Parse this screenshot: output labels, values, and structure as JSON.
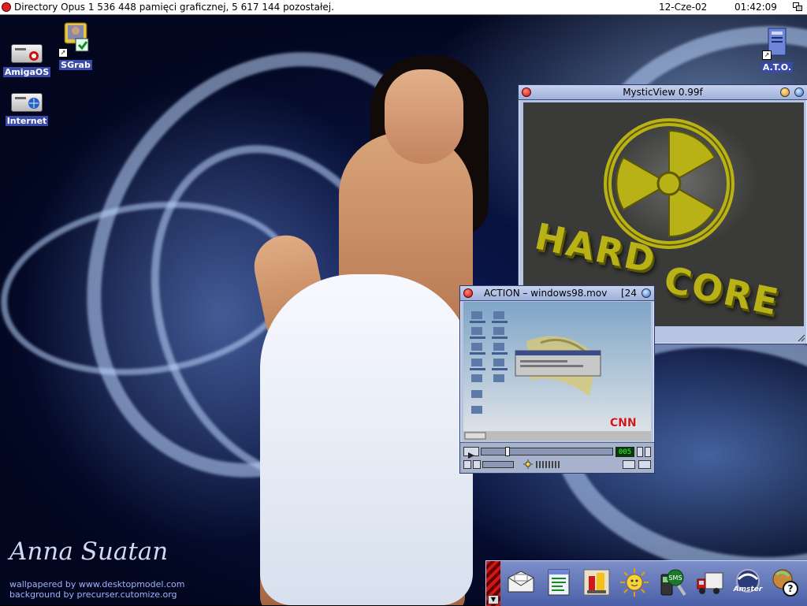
{
  "screen": {
    "title": "Directory Opus   1 536 448 pamięci graficznej, 5 617 144 pozostałej.",
    "date": "12-Cze-02",
    "time": "01:42:09"
  },
  "desktop_icons": [
    {
      "id": "amigaos",
      "label": "AmigaOS",
      "icon": "harddisk-icon"
    },
    {
      "id": "sgrab",
      "label": "SGrab",
      "icon": "screengrab-icon"
    },
    {
      "id": "internet",
      "label": "Internet",
      "icon": "harddisk-icon"
    },
    {
      "id": "ato",
      "label": "A.T.O.",
      "icon": "computer-icon"
    }
  ],
  "wallpaper": {
    "name": "Anna Suatan",
    "line1": "wallpapered by www.desktopmodel.com",
    "line2": "background by precurser.cutomize.org"
  },
  "mysticview": {
    "title": "MysticView 0.99f",
    "image_text_1": "HARD",
    "image_text_2": "CORE"
  },
  "action": {
    "title": "ACTION – windows98.mov",
    "title_suffix": "[24",
    "counter": "005",
    "watermark": "CNN"
  },
  "dock": {
    "items": [
      "mail-icon",
      "notepad-icon",
      "tools-icon",
      "sun-icon",
      "sms-phone-icon",
      "truck-icon",
      "amster-icon",
      "help-icon"
    ],
    "amster_label": "Amster"
  },
  "colors": {
    "desktop": "#0c1a55",
    "window": "#b7c4e2",
    "label_bg": "#3a4aa8",
    "hardcore": "#b9b216"
  }
}
